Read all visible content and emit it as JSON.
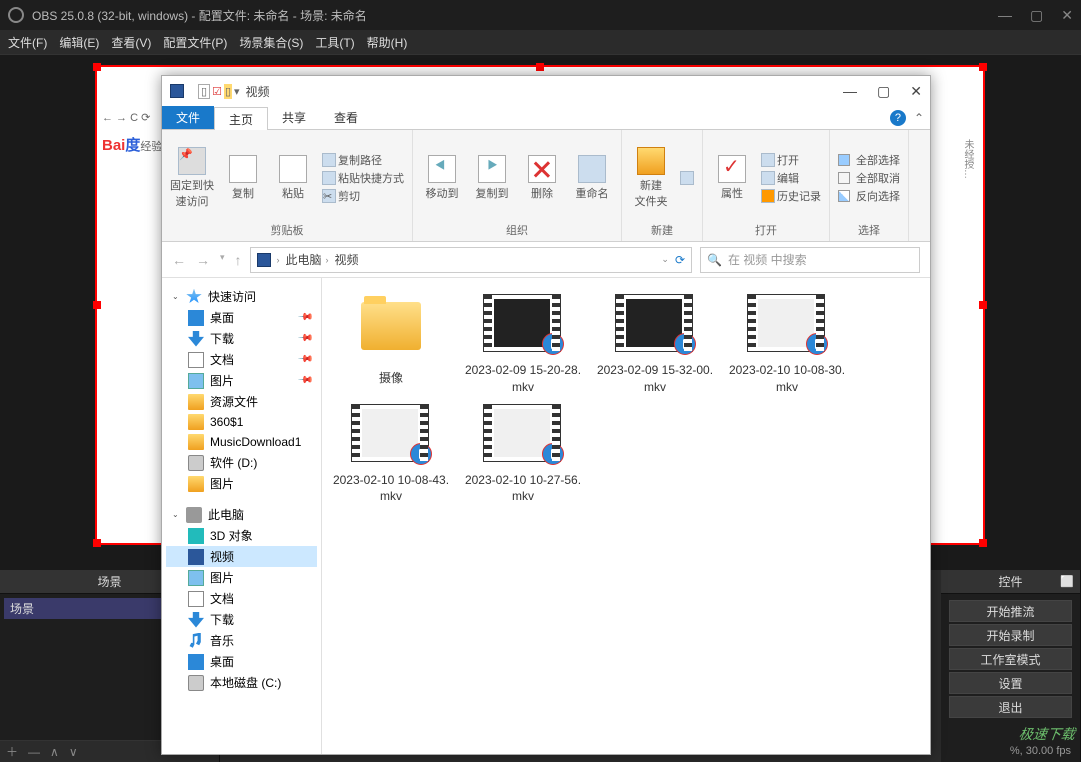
{
  "obs": {
    "title": "OBS 25.0.8 (32-bit, windows) - 配置文件: 未命名 - 场景: 未命名",
    "menu": [
      "文件(F)",
      "编辑(E)",
      "查看(V)",
      "配置文件(P)",
      "场景集合(S)",
      "工具(T)",
      "帮助(H)"
    ],
    "scenes_title": "场景",
    "scene_item": "场景",
    "controls_title": "控件",
    "controls": [
      "开始推流",
      "开始录制",
      "工作室模式",
      "设置",
      "退出"
    ],
    "status": "%, 30.00 fps",
    "watermark": "极速下载"
  },
  "explorer": {
    "window_title": "视频",
    "tabs": {
      "file": "文件",
      "home": "主页",
      "share": "共享",
      "view": "查看"
    },
    "ribbon": {
      "pin": "固定到快\n速访问",
      "copy": "复制",
      "paste": "粘贴",
      "copypath": "复制路径",
      "pasteshortcut": "粘贴快捷方式",
      "cut": "剪切",
      "clipboard": "剪贴板",
      "moveto": "移动到",
      "copyto": "复制到",
      "delete": "删除",
      "rename": "重命名",
      "organize": "组织",
      "newfolder": "新建\n文件夹",
      "new": "新建",
      "properties": "属性",
      "open_btn": "打开",
      "edit": "编辑",
      "history": "历史记录",
      "open": "打开",
      "selall": "全部选择",
      "selnone": "全部取消",
      "selinv": "反向选择",
      "select": "选择"
    },
    "address": {
      "pc": "此电脑",
      "videos": "视频"
    },
    "search_placeholder": "在 视频 中搜索",
    "sidebar": {
      "quick": "快速访问",
      "desktop": "桌面",
      "downloads": "下载",
      "documents": "文档",
      "pictures": "图片",
      "res": "资源文件",
      "threesixty": "360$1",
      "musicdl": "MusicDownload1",
      "drive_d": "软件 (D:)",
      "pics2": "图片",
      "thispc": "此电脑",
      "objects3d": "3D 对象",
      "videos": "视频",
      "music": "音乐",
      "desk2": "桌面",
      "localc": "本地磁盘 (C:)"
    },
    "files": [
      {
        "type": "folder",
        "name": "摄像"
      },
      {
        "type": "video",
        "name": "2023-02-09 15-20-28.mkv",
        "style": "dark"
      },
      {
        "type": "video",
        "name": "2023-02-09 15-32-00.mkv",
        "style": "dark"
      },
      {
        "type": "video",
        "name": "2023-02-10 10-08-30.mkv",
        "style": "light"
      },
      {
        "type": "video",
        "name": "2023-02-10 10-08-43.mkv",
        "style": "light"
      },
      {
        "type": "video",
        "name": "2023-02-10 10-27-56.mkv",
        "style": "light"
      }
    ]
  }
}
